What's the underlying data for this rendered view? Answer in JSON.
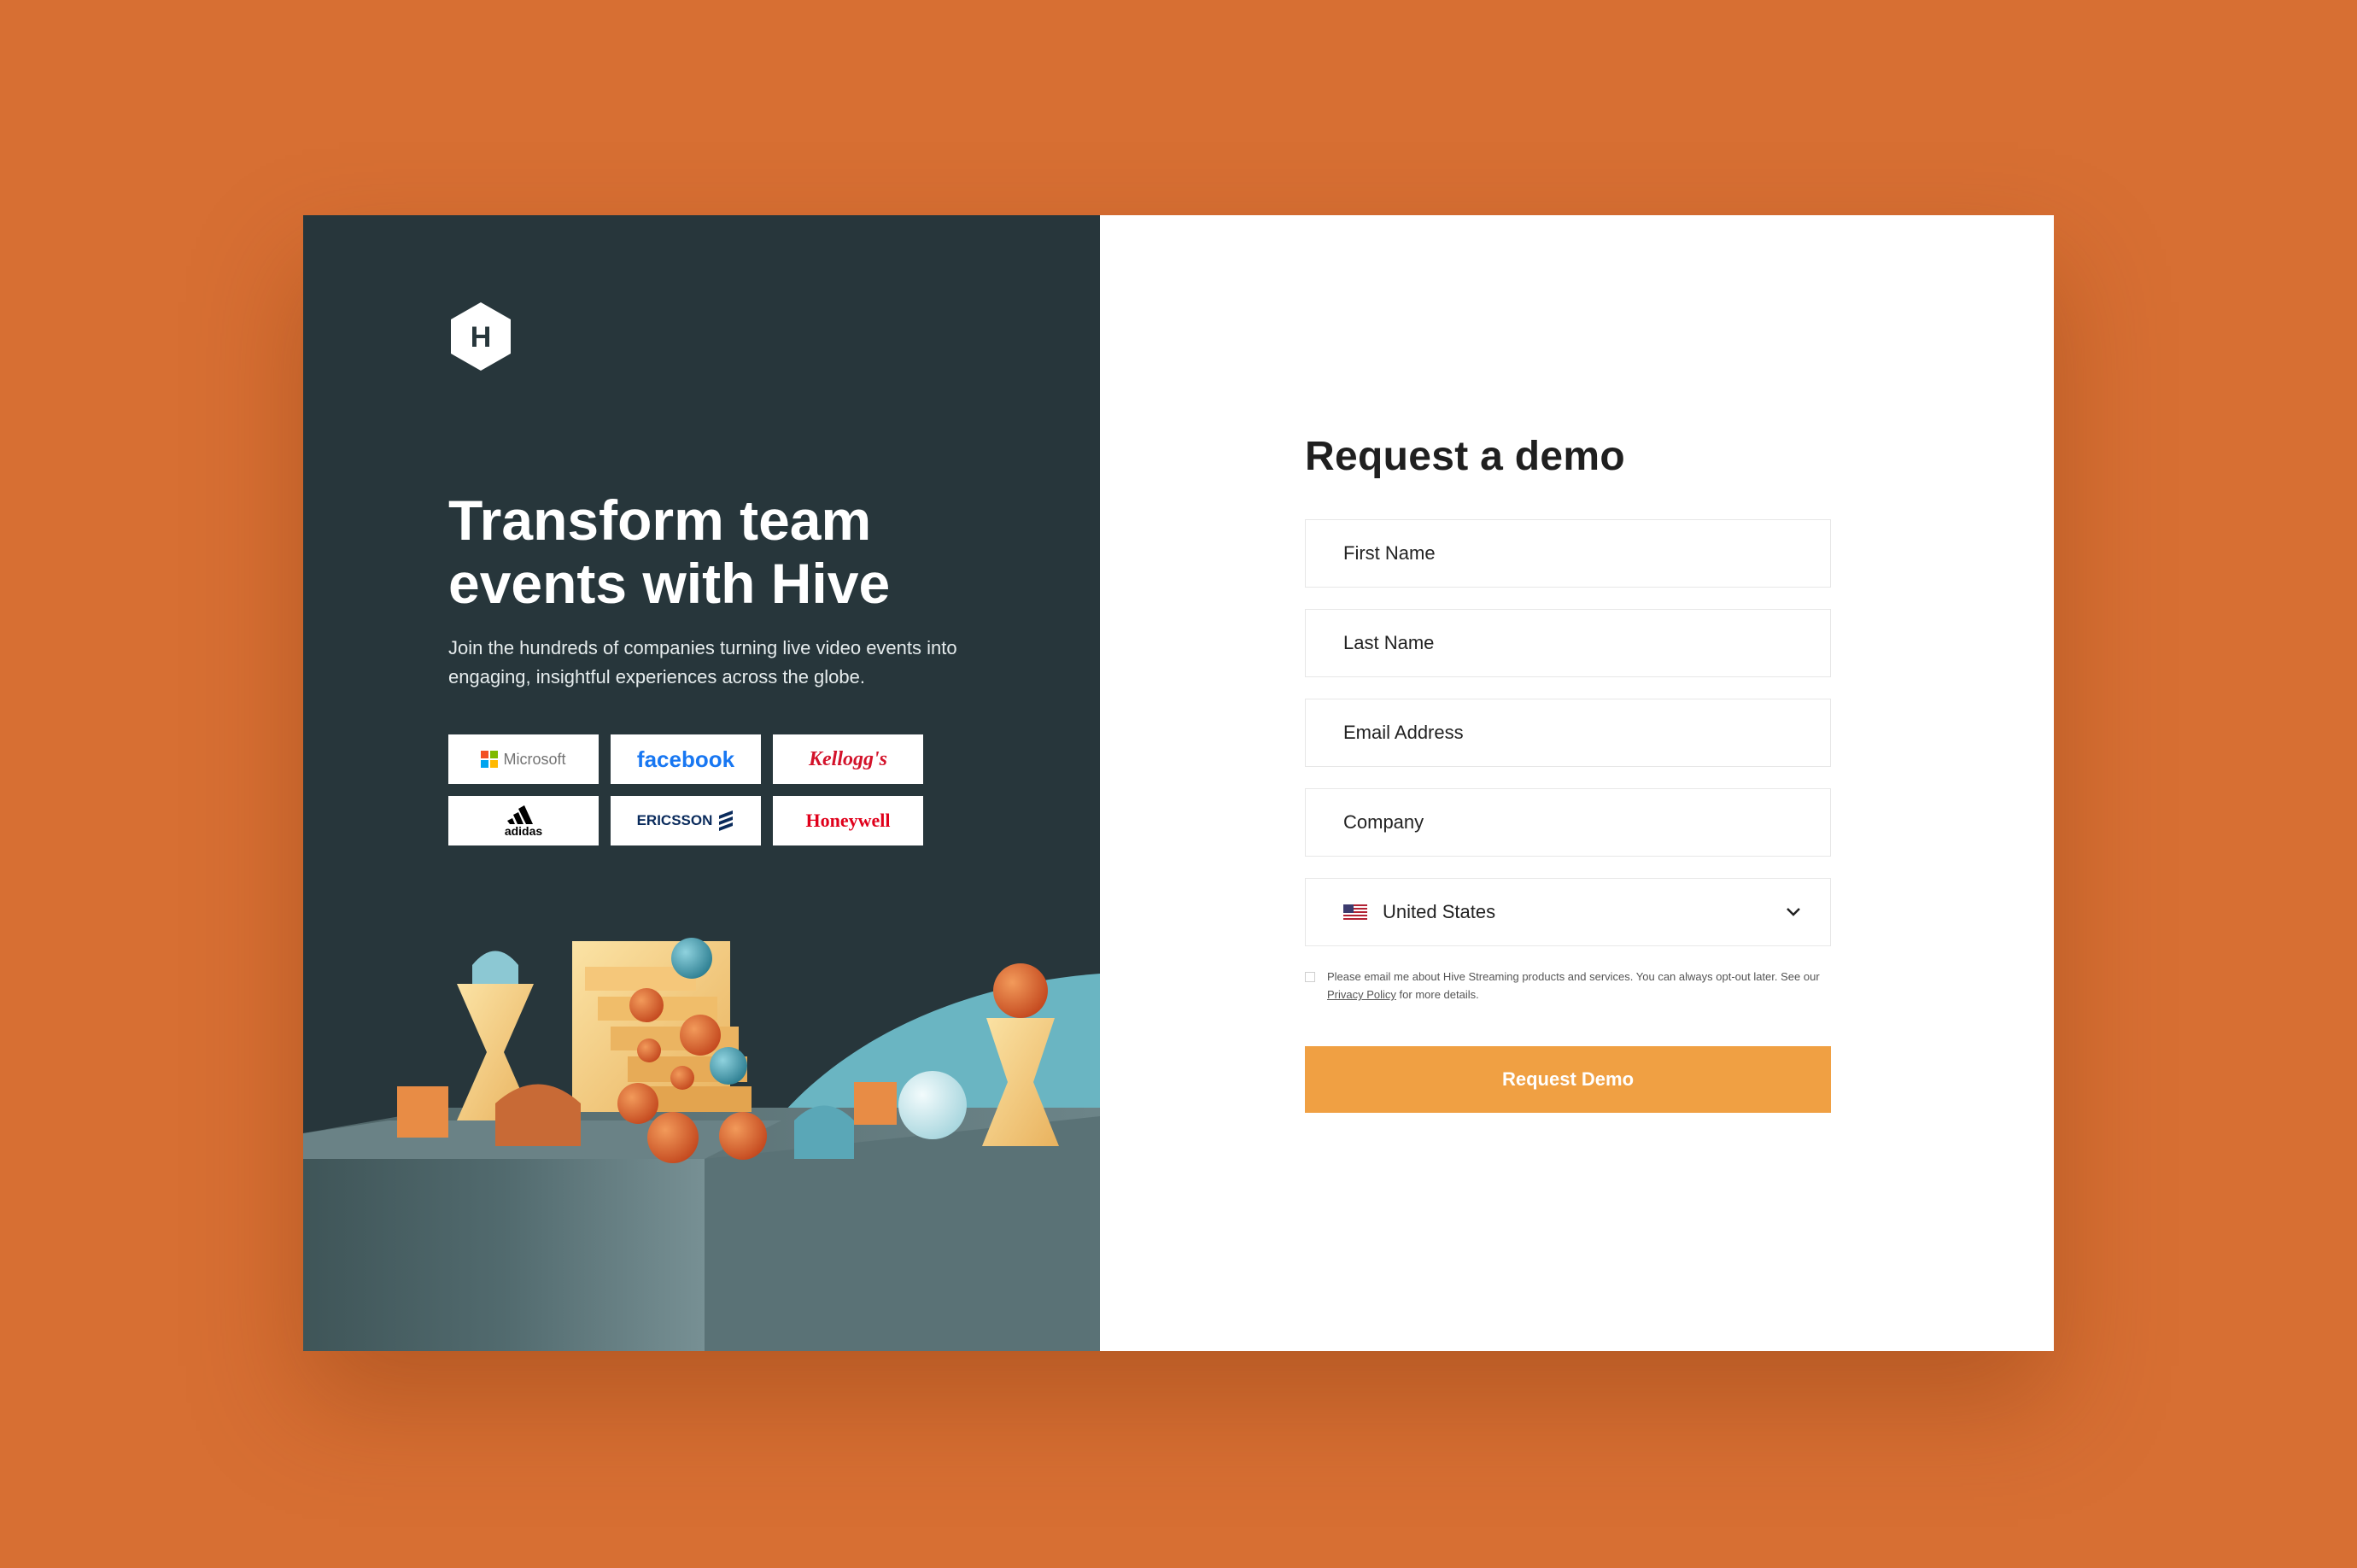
{
  "colors": {
    "background": "#d76f33",
    "left_panel": "#27363b",
    "accent_button": "#f0a043",
    "teal_shape": "#6ab5c2"
  },
  "brand": {
    "logo_letter": "H"
  },
  "hero": {
    "headline": "Transform team events with Hive",
    "subtext": "Join the hundreds of companies turning live video events into engaging, insightful experiences across the globe."
  },
  "logos": [
    {
      "name": "Microsoft"
    },
    {
      "name": "facebook"
    },
    {
      "name": "Kellogg's"
    },
    {
      "name": "adidas"
    },
    {
      "name": "ERICSSON"
    },
    {
      "name": "Honeywell"
    }
  ],
  "form": {
    "title": "Request a demo",
    "first_name_placeholder": "First Name",
    "last_name_placeholder": "Last Name",
    "email_placeholder": "Email Address",
    "company_placeholder": "Company",
    "country_value": "United States",
    "consent_text_before": "Please email me about Hive Streaming products and services. You can always opt-out later. See our ",
    "consent_link": "Privacy Policy",
    "consent_text_after": " for more details.",
    "submit_label": "Request Demo"
  }
}
